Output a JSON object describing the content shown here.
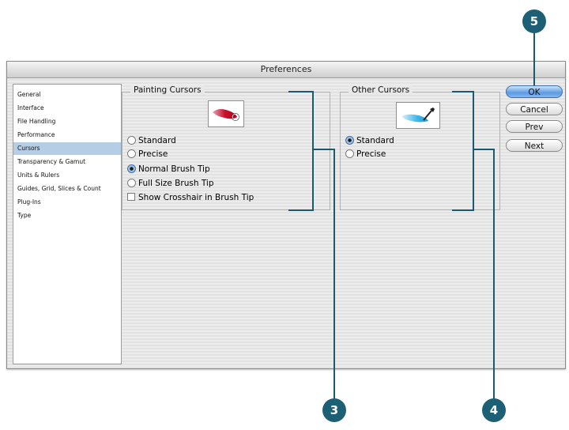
{
  "window": {
    "title": "Preferences"
  },
  "sidebar": {
    "items": [
      {
        "label": "General"
      },
      {
        "label": "Interface"
      },
      {
        "label": "File Handling"
      },
      {
        "label": "Performance"
      },
      {
        "label": "Cursors",
        "selected": true
      },
      {
        "label": "Transparency & Gamut"
      },
      {
        "label": "Units & Rulers"
      },
      {
        "label": "Guides, Grid, Slices & Count"
      },
      {
        "label": "Plug-Ins"
      },
      {
        "label": "Type"
      }
    ]
  },
  "painting_cursors": {
    "title": "Painting Cursors",
    "options": [
      {
        "label": "Standard",
        "selected": false
      },
      {
        "label": "Precise",
        "selected": false
      },
      {
        "label": "Normal Brush Tip",
        "selected": true
      },
      {
        "label": "Full Size Brush Tip",
        "selected": false
      }
    ],
    "checkbox": {
      "label": "Show Crosshair in Brush Tip",
      "checked": false
    }
  },
  "other_cursors": {
    "title": "Other Cursors",
    "options": [
      {
        "label": "Standard",
        "selected": true
      },
      {
        "label": "Precise",
        "selected": false
      }
    ]
  },
  "buttons": {
    "ok": "OK",
    "cancel": "Cancel",
    "prev": "Prev",
    "next": "Next"
  },
  "callouts": {
    "painting": "3",
    "other": "4",
    "ok": "5"
  },
  "colors": {
    "callout": "#1d6075",
    "accent": "#5b9ae3",
    "selected_row": "#b6cde6"
  }
}
